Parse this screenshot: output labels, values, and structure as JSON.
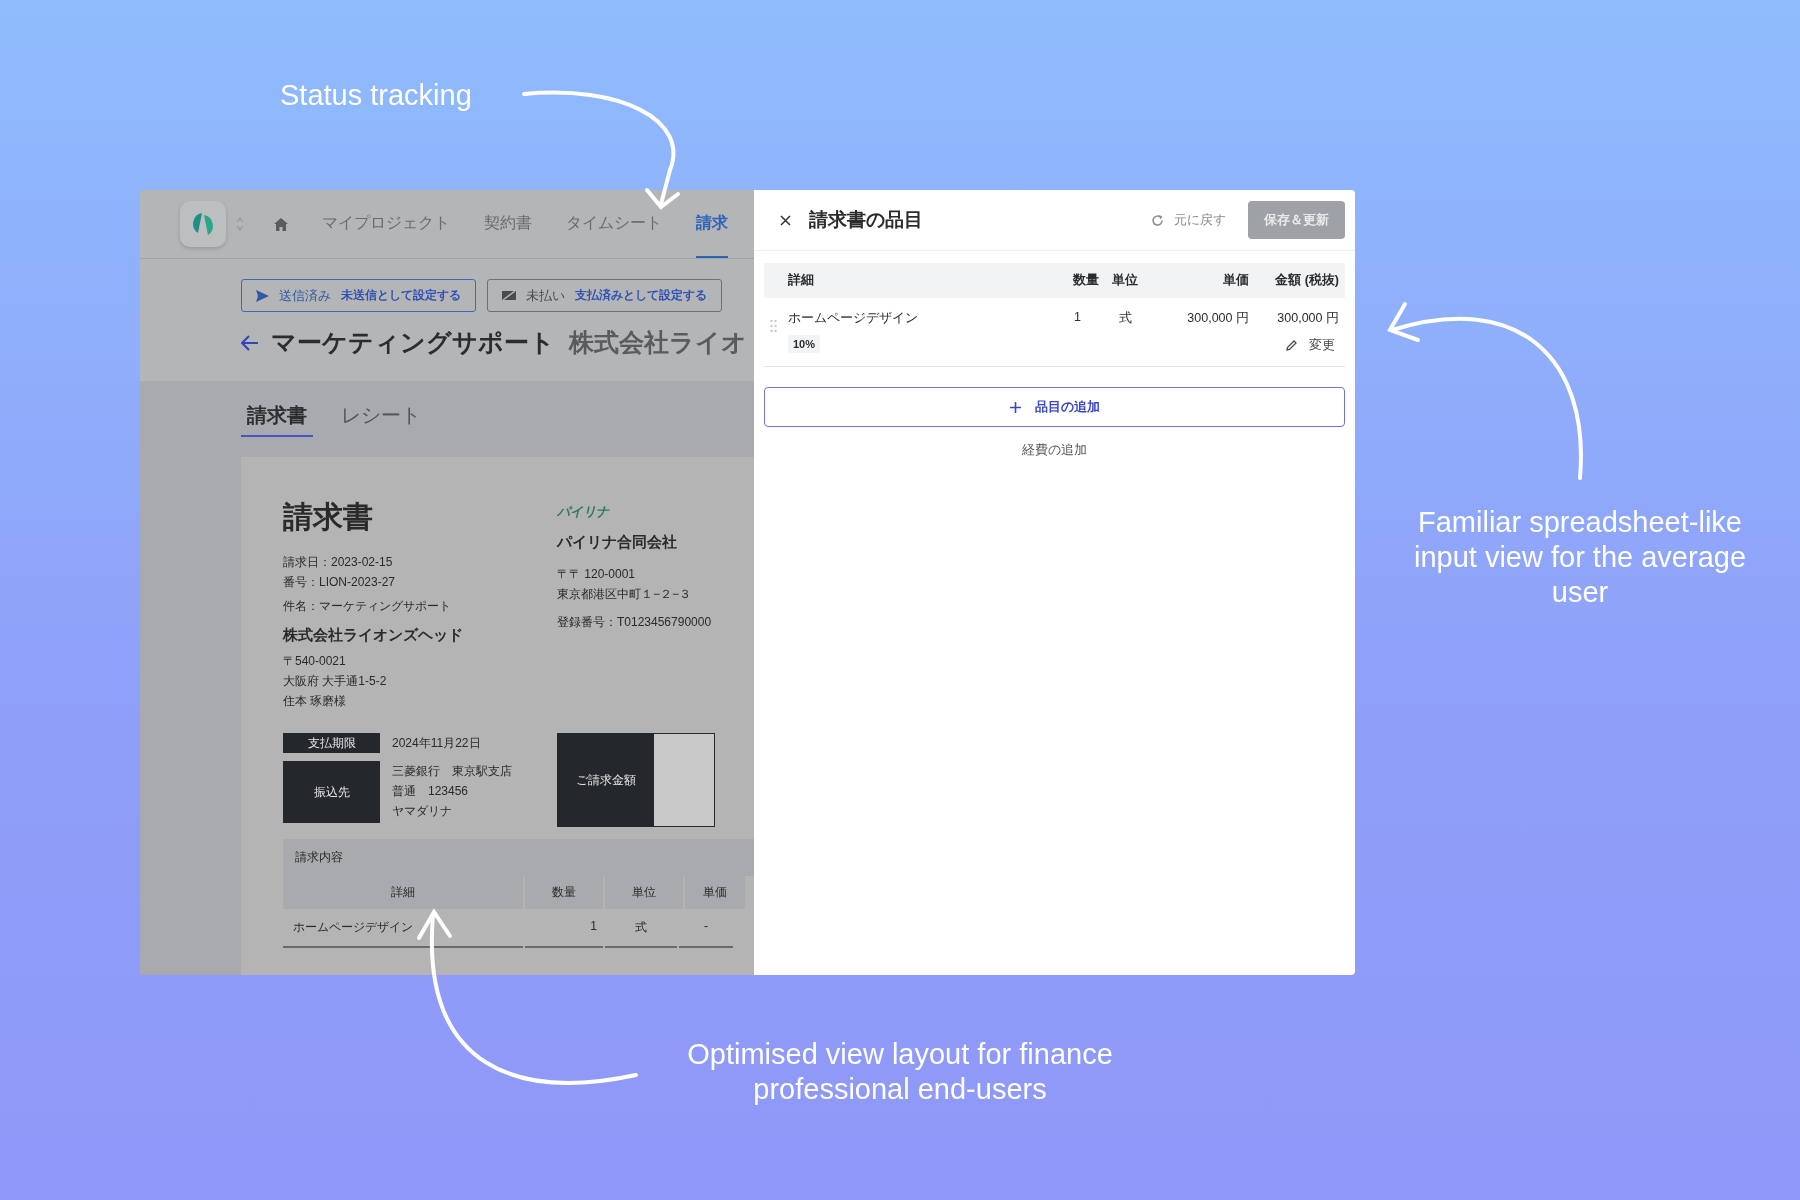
{
  "annotations": [
    {
      "text": "Status tracking"
    },
    {
      "text": "Familiar spreadsheet-like input view for the average user"
    },
    {
      "text": "Optimised view layout for finance professional end-users"
    }
  ],
  "app": {
    "nav": [
      {
        "label": "マイプロジェクト",
        "selected": false
      },
      {
        "label": "契約書",
        "selected": false
      },
      {
        "label": "タイムシート",
        "selected": false
      },
      {
        "label": "請求",
        "selected": true
      }
    ],
    "status_buttons": [
      {
        "kind": "sent",
        "status": "送信済み",
        "action": "未送信として設定する"
      },
      {
        "kind": "unpaid",
        "status": "未払い",
        "action": "支払済みとして設定する"
      }
    ],
    "title": "マーケティングサポート",
    "client": "株式会社ライオ",
    "tabs": [
      {
        "label": "請求書",
        "selected": true
      },
      {
        "label": "レシート",
        "selected": false
      }
    ],
    "invoice": {
      "heading": "請求書",
      "meta": [
        "請求日：2023-02-15",
        "番号：LION-2023-27"
      ],
      "subject": "件名：マーケティングサポート",
      "client": "株式会社ライオンズヘッド",
      "client_address": [
        "〒540-0021",
        "大阪府 大手通1-5-2",
        "住本 琢磨様"
      ],
      "issuer_logo": "パイリナ",
      "issuer": "パイリナ合同会社",
      "issuer_address": [
        "〒〒 120-0001",
        "東京都港区中町１−２−３"
      ],
      "registration": "登録番号：T0123456790000",
      "due_label": "支払期限",
      "due_date": "2024年11月22日",
      "bank_label": "振込先",
      "bank_lines": [
        "三菱銀行　東京駅支店",
        "普通　123456",
        "ヤマダリナ"
      ],
      "total_label": "ご請求金額",
      "section": "請求内容",
      "columns": [
        "詳細",
        "数量",
        "単位",
        "単価"
      ],
      "rows": [
        [
          "ホームページデザイン",
          "1",
          "式",
          "-"
        ]
      ]
    }
  },
  "drawer": {
    "title": "請求書の品目",
    "revert": "元に戻す",
    "save": {
      "label": "保存＆更新",
      "disabled": true
    },
    "columns": [
      "詳細",
      "数量",
      "単位",
      "単価",
      "金額 (税抜)"
    ],
    "rows": [
      {
        "detail": "ホームページデザイン",
        "tax": "10%",
        "qty": "1",
        "unit": "式",
        "price": "300,000 円",
        "amount": "300,000 円",
        "edit": "変更"
      }
    ],
    "add_item": "品目の追加",
    "add_expense": "経費の追加"
  }
}
